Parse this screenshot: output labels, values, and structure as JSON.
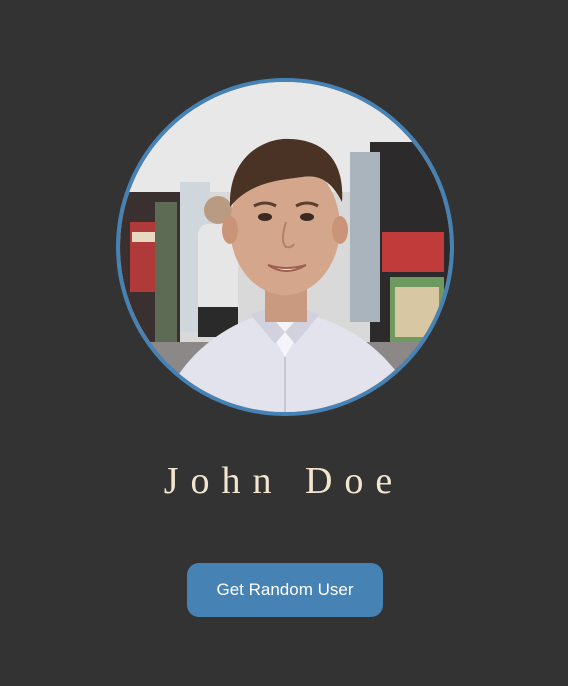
{
  "profile": {
    "name": "John Doe"
  },
  "actions": {
    "random_user_label": "Get Random User"
  },
  "colors": {
    "background": "#333333",
    "accent": "#4682b4",
    "name_text": "#f3e6cf",
    "button_text": "#ffffff"
  }
}
